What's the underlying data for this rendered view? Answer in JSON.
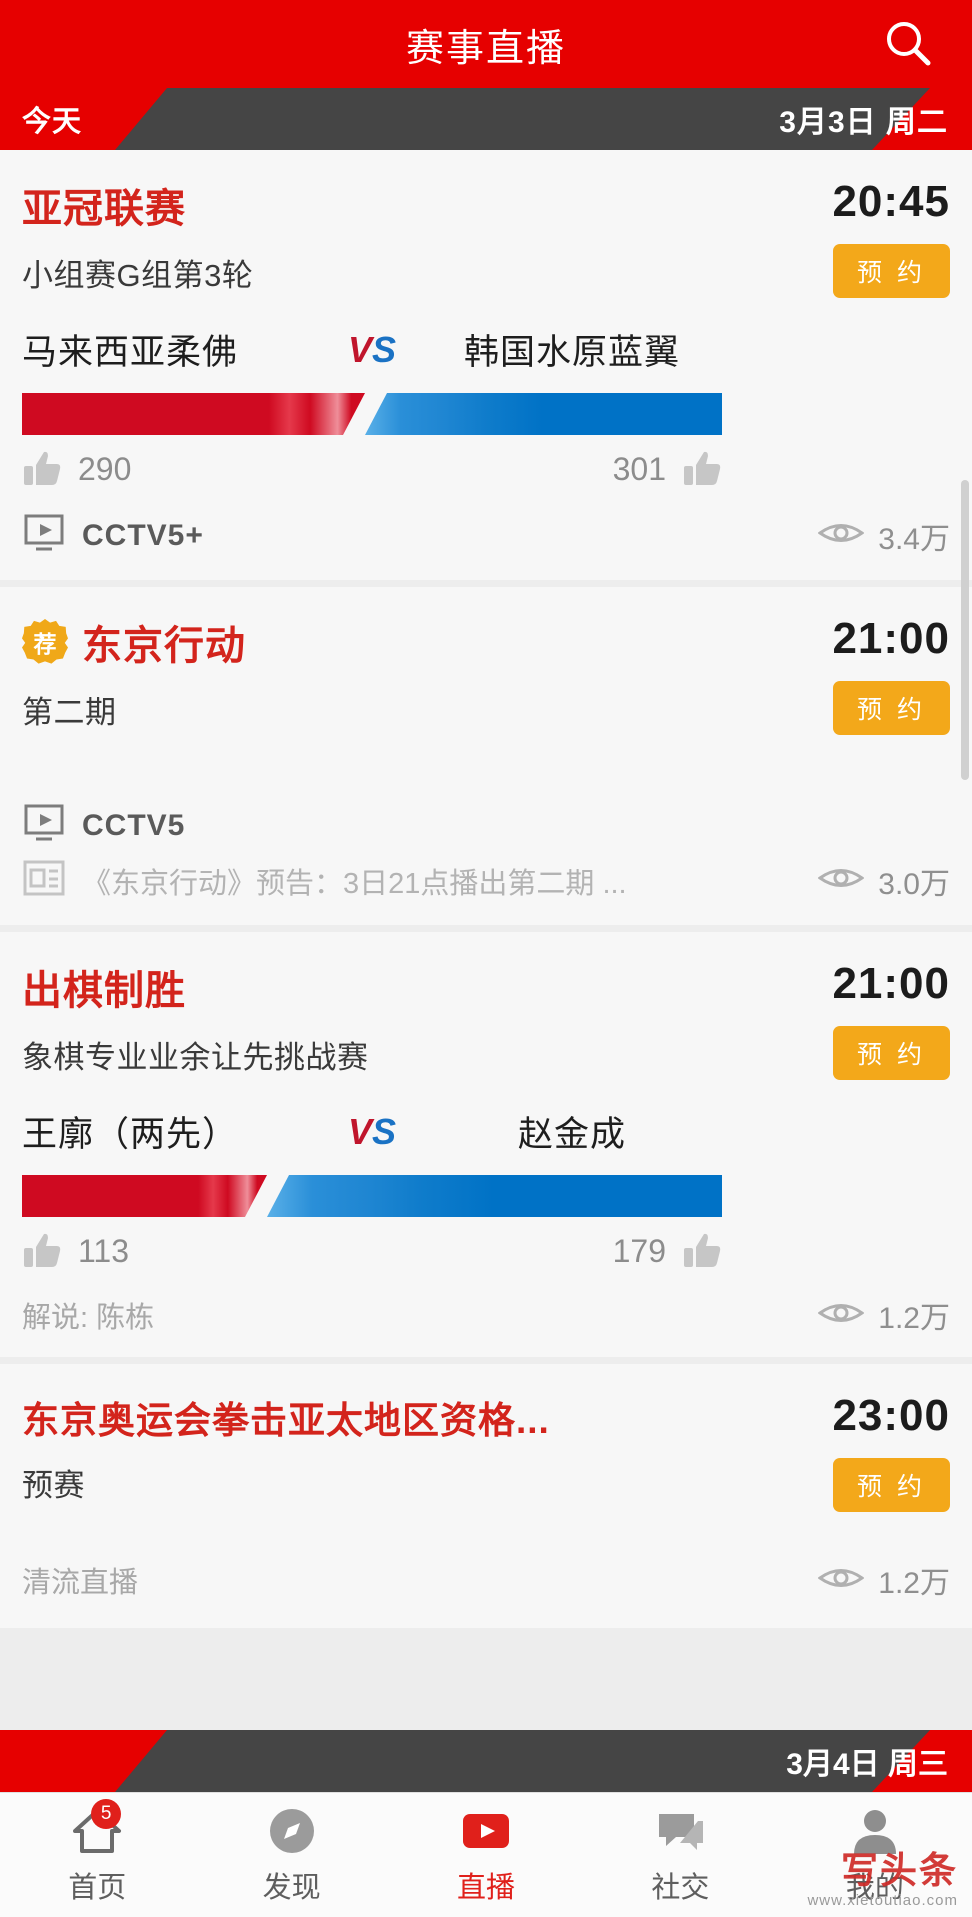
{
  "header": {
    "title": "赛事直播",
    "search_icon": "search-icon"
  },
  "datebar": {
    "today_label": "今天",
    "date_label": "3月3日 周二"
  },
  "next_day_bar": {
    "date_label": "3月4日 周三"
  },
  "colors": {
    "brand_red": "#e60000",
    "title_red": "#d3241c",
    "reserve_orange": "#f3a81a",
    "bar_red": "#cf0a21",
    "bar_blue": "#0072c6",
    "dark_gray": "#454545"
  },
  "cards": [
    {
      "title": "亚冠联赛",
      "subtitle": "小组赛G组第3轮",
      "time": "20:45",
      "reserve_label": "预 约",
      "recommended": false,
      "vs": {
        "team_left": "马来西亚柔佛",
        "vs_label_v": "V",
        "vs_label_s": "S",
        "team_right": "韩国水原蓝翼",
        "votes_left": "290",
        "votes_right": "301",
        "left_percent": 49,
        "right_percent": 51
      },
      "channel": "CCTV5+",
      "channel_icon": "tv-monitor-icon",
      "views": "3.4万",
      "views_icon": "eye-icon"
    },
    {
      "title": "东京行动",
      "subtitle": "第二期",
      "time": "21:00",
      "reserve_label": "预 约",
      "recommended": true,
      "recommend_badge": "荐",
      "channel": "CCTV5",
      "channel_icon": "tv-monitor-icon",
      "description": "《东京行动》预告：3日21点播出第二期 ...",
      "description_icon": "news-article-icon",
      "views": "3.0万",
      "views_icon": "eye-icon"
    },
    {
      "title": "出棋制胜",
      "subtitle": "象棋专业业余让先挑战赛",
      "time": "21:00",
      "reserve_label": "预 约",
      "recommended": false,
      "vs": {
        "team_left": "王廓（两先）",
        "vs_label_v": "V",
        "vs_label_s": "S",
        "team_right": "赵金成",
        "votes_left": "113",
        "votes_right": "179",
        "left_percent": 35,
        "right_percent": 65
      },
      "commentator": "解说: 陈栋",
      "views": "1.2万",
      "views_icon": "eye-icon"
    },
    {
      "title": "东京奥运会拳击亚太地区资格...",
      "subtitle": "预赛",
      "time": "23:00",
      "reserve_label": "预 约",
      "recommended": false,
      "channel": "清流直播",
      "views": "1.2万",
      "views_icon": "eye-icon"
    }
  ],
  "tabbar": {
    "items": [
      {
        "label": "首页",
        "icon": "home-icon",
        "badge": "5",
        "active": false
      },
      {
        "label": "发现",
        "icon": "compass-icon",
        "badge": null,
        "active": false
      },
      {
        "label": "直播",
        "icon": "live-play-icon",
        "badge": null,
        "active": true
      },
      {
        "label": "社交",
        "icon": "chat-icon",
        "badge": null,
        "active": false
      },
      {
        "label": "我的",
        "icon": "person-icon",
        "badge": null,
        "active": false
      }
    ]
  },
  "watermark": {
    "main": "头条",
    "main_prefix": "写头条",
    "sub": "www.xietoutiao.com"
  }
}
